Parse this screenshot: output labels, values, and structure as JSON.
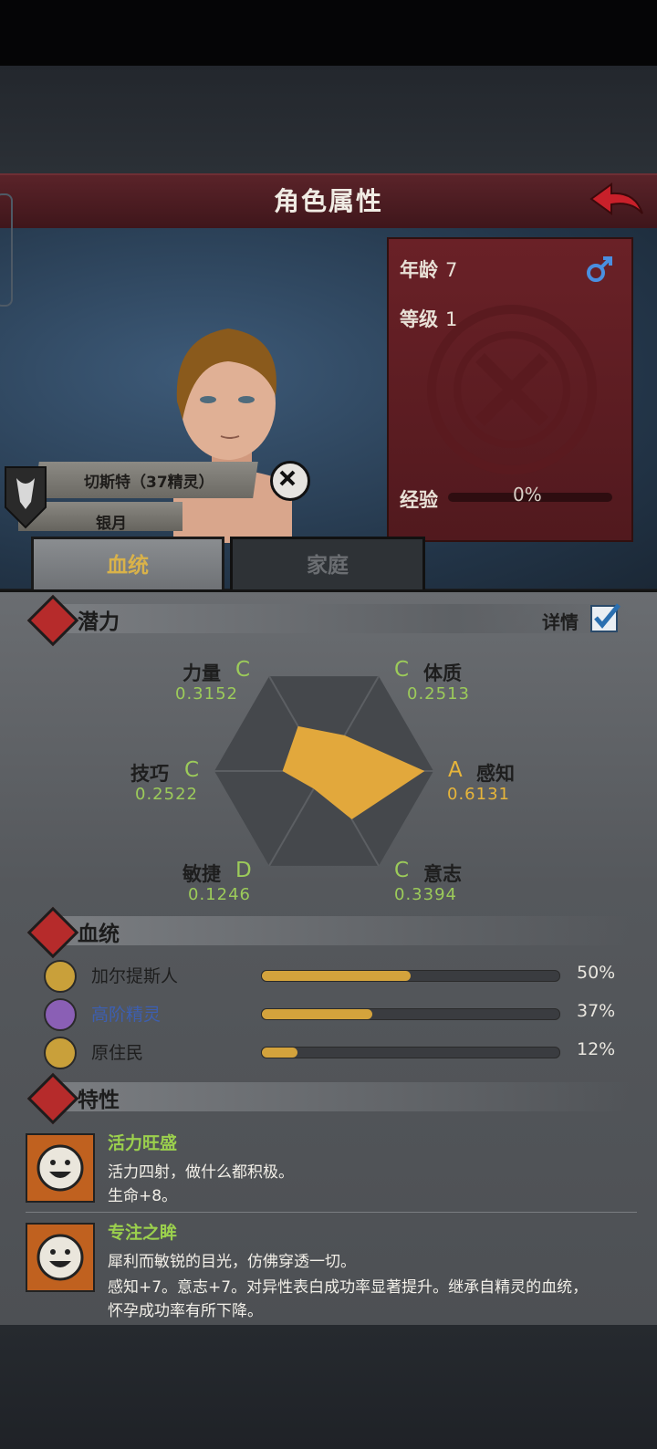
{
  "header": {
    "title": "角色属性"
  },
  "character": {
    "age_label": "年龄",
    "age": "7",
    "level_label": "等级",
    "level": "1",
    "exp_label": "经验",
    "exp_pct": "0%",
    "exp_fraction": 0.0,
    "name": "切斯特（37精灵）",
    "title": "银月"
  },
  "tabs": {
    "bloodline": "血统",
    "family": "家庭"
  },
  "potential": {
    "section_title": "潜力",
    "detail_label": "详情",
    "stats": [
      {
        "name": "力量",
        "grade": "C",
        "value": "0.3152"
      },
      {
        "name": "体质",
        "grade": "C",
        "value": "0.2513"
      },
      {
        "name": "感知",
        "grade": "A",
        "value": "0.6131"
      },
      {
        "name": "意志",
        "grade": "C",
        "value": "0.3394"
      },
      {
        "name": "敏捷",
        "grade": "D",
        "value": "0.1246"
      },
      {
        "name": "技巧",
        "grade": "C",
        "value": "0.2522"
      }
    ]
  },
  "bloodline": {
    "section_title": "血统",
    "items": [
      {
        "name": "加尔提斯人",
        "pct": "50%",
        "fraction": 0.5,
        "name_color": "#1e1e1e"
      },
      {
        "name": "高阶精灵",
        "pct": "37%",
        "fraction": 0.37,
        "name_color": "#3d5fb0"
      },
      {
        "name": "原住民",
        "pct": "12%",
        "fraction": 0.12,
        "name_color": "#1e1e1e"
      }
    ]
  },
  "traits": {
    "section_title": "特性",
    "items": [
      {
        "title": "活力旺盛",
        "desc1": "活力四射，做什么都积极。",
        "desc2": "生命+8。",
        "desc3": ""
      },
      {
        "title": "专注之眸",
        "desc1": "犀利而敏锐的目光，仿佛穿透一切。",
        "desc2": "感知+7。意志+7。对异性表白成功率显著提升。继承自精灵的血统，",
        "desc3": "怀孕成功率有所下降。"
      }
    ]
  },
  "colors": {
    "accent_gold": "#d4a33c",
    "grade_green": "#9ccb5a",
    "banner_red": "#5a2329"
  }
}
